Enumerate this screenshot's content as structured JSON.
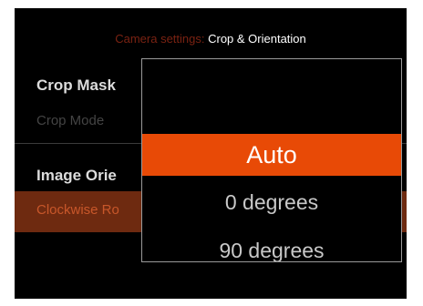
{
  "header": {
    "prefix": "Camera settings:",
    "title": "Crop & Orientation"
  },
  "sections": [
    {
      "title": "Crop Mask",
      "row_label": "Crop Mode"
    },
    {
      "title": "Image Orie",
      "row_label": "Clockwise Ro"
    }
  ],
  "popup": {
    "options": [
      "Auto",
      "0 degrees",
      "90 degrees"
    ],
    "selected_index": 0
  },
  "colors": {
    "accent": "#e84a06",
    "accent_dark": "#6e2a10",
    "background": "#000000"
  }
}
